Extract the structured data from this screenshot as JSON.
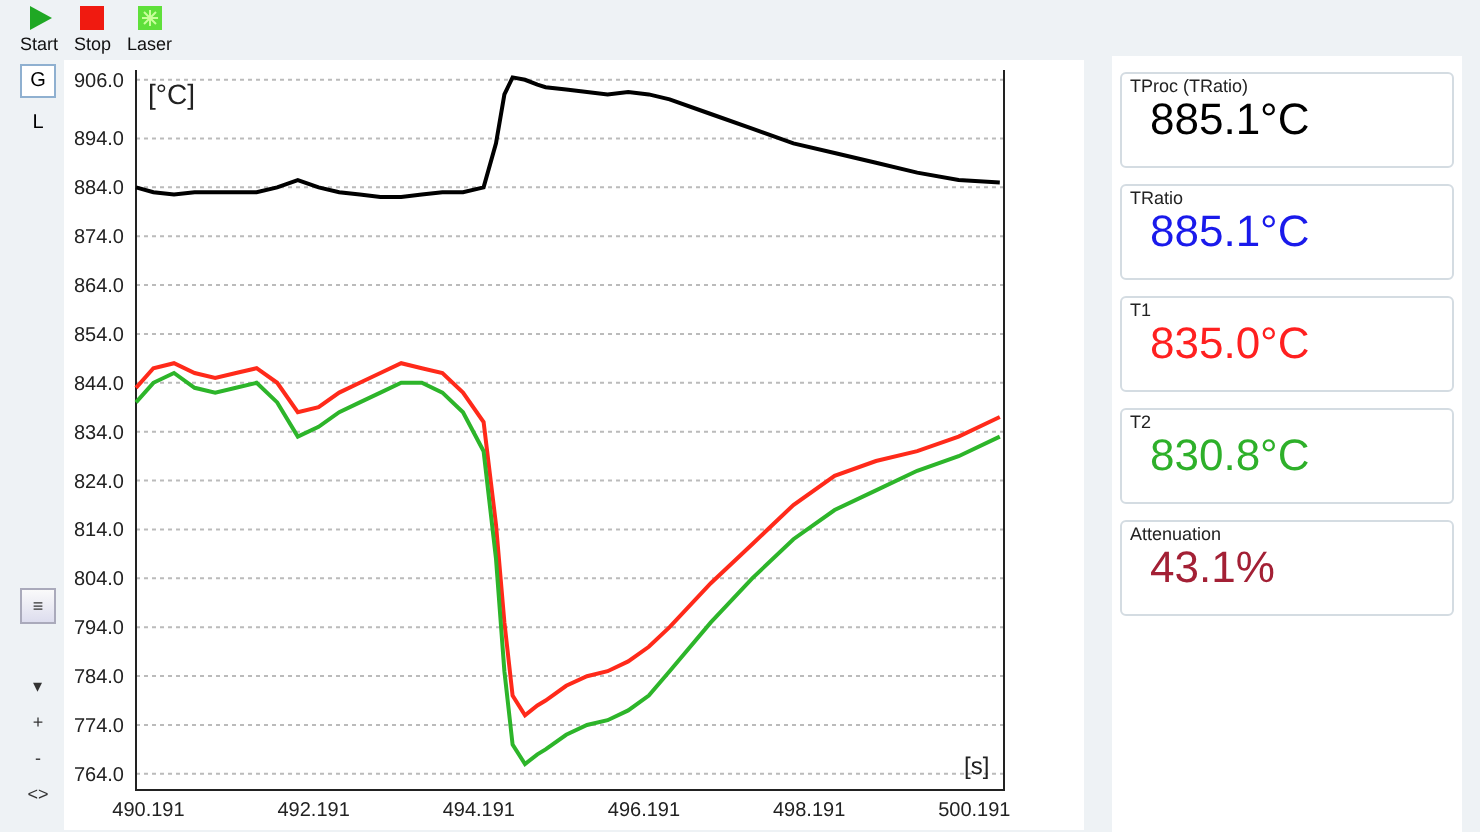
{
  "toolbar": [
    {
      "kind": "start",
      "label": "Start"
    },
    {
      "kind": "stop",
      "label": "Stop"
    },
    {
      "kind": "laser",
      "label": "Laser"
    }
  ],
  "view_buttons": [
    {
      "label": "G",
      "selected": true
    },
    {
      "label": "L",
      "selected": false
    }
  ],
  "side_controls": [
    {
      "label": "≡"
    },
    {
      "label": "▾"
    },
    {
      "label": "+"
    },
    {
      "label": "-"
    },
    {
      "label": "<>"
    }
  ],
  "chart": {
    "chart_data": {
      "type": "line",
      "ylabel": "[°C]",
      "xlabel": "[s]",
      "grid": true,
      "x": [
        490.04,
        490.25,
        490.5,
        490.75,
        491.0,
        491.25,
        491.5,
        491.75,
        492.0,
        492.25,
        492.5,
        492.75,
        493.0,
        493.25,
        493.5,
        493.75,
        494.0,
        494.25,
        494.4,
        494.5,
        494.6,
        494.75,
        494.9,
        495.0,
        495.25,
        495.5,
        495.75,
        496.0,
        496.25,
        496.5,
        497.0,
        497.5,
        498.0,
        498.5,
        499.0,
        499.5,
        500.0,
        500.5
      ],
      "series": [
        {
          "color": "#000000",
          "values": [
            884,
            883,
            882.5,
            883,
            883,
            883,
            883,
            884,
            885.5,
            884,
            883,
            882.5,
            882,
            882,
            882.5,
            883,
            883,
            884,
            893,
            903,
            906.5,
            906,
            905,
            904.5,
            904,
            903.5,
            903,
            903.5,
            903,
            902,
            899,
            896,
            893,
            891,
            889,
            887,
            885.5,
            885
          ]
        },
        {
          "color": "#ff2a1a",
          "values": [
            843,
            847,
            848,
            846,
            845,
            846,
            847,
            844,
            838,
            839,
            842,
            844,
            846,
            848,
            847,
            846,
            842,
            836,
            815,
            795,
            780,
            776,
            778,
            779,
            782,
            784,
            785,
            787,
            790,
            794,
            803,
            811,
            819,
            825,
            828,
            830,
            833,
            837
          ]
        },
        {
          "color": "#2db52a",
          "values": [
            840,
            844,
            846,
            843,
            842,
            843,
            844,
            840,
            833,
            835,
            838,
            840,
            842,
            844,
            844,
            842,
            838,
            830,
            808,
            785,
            770,
            766,
            768,
            769,
            772,
            774,
            775,
            777,
            780,
            785,
            795,
            804,
            812,
            818,
            822,
            826,
            829,
            833
          ]
        }
      ],
      "xlim": [
        490.04,
        500.55
      ],
      "ylim": [
        760.7,
        908
      ],
      "xticks": [
        {
          "value": 490.191,
          "label": "490.191"
        },
        {
          "value": 492.191,
          "label": "492.191"
        },
        {
          "value": 494.191,
          "label": "494.191"
        },
        {
          "value": 496.191,
          "label": "496.191"
        },
        {
          "value": 498.191,
          "label": "498.191"
        },
        {
          "value": 500.191,
          "label": "500.191"
        }
      ],
      "yticks": [
        {
          "value": 906,
          "label": "906.0"
        },
        {
          "value": 894,
          "label": "894.0"
        },
        {
          "value": 884,
          "label": "884.0"
        },
        {
          "value": 874,
          "label": "874.0"
        },
        {
          "value": 864,
          "label": "864.0"
        },
        {
          "value": 854,
          "label": "854.0"
        },
        {
          "value": 844,
          "label": "844.0"
        },
        {
          "value": 834,
          "label": "834.0"
        },
        {
          "value": 824,
          "label": "824.0"
        },
        {
          "value": 814,
          "label": "814.0"
        },
        {
          "value": 804,
          "label": "804.0"
        },
        {
          "value": 794,
          "label": "794.0"
        },
        {
          "value": 784,
          "label": "784.0"
        },
        {
          "value": 774,
          "label": "774.0"
        },
        {
          "value": 764,
          "label": "764.0"
        }
      ]
    }
  },
  "readouts": [
    {
      "label": "TProc (TRatio)",
      "value": "885.1°C",
      "color": "#000000"
    },
    {
      "label": "TRatio",
      "value": "885.1°C",
      "color": "#1a1aeb"
    },
    {
      "label": "T1",
      "value": "835.0°C",
      "color": "#ff2020"
    },
    {
      "label": "T2",
      "value": "830.8°C",
      "color": "#2eb02a"
    },
    {
      "label": "Attenuation",
      "value": "43.1%",
      "color": "#a32035"
    }
  ]
}
